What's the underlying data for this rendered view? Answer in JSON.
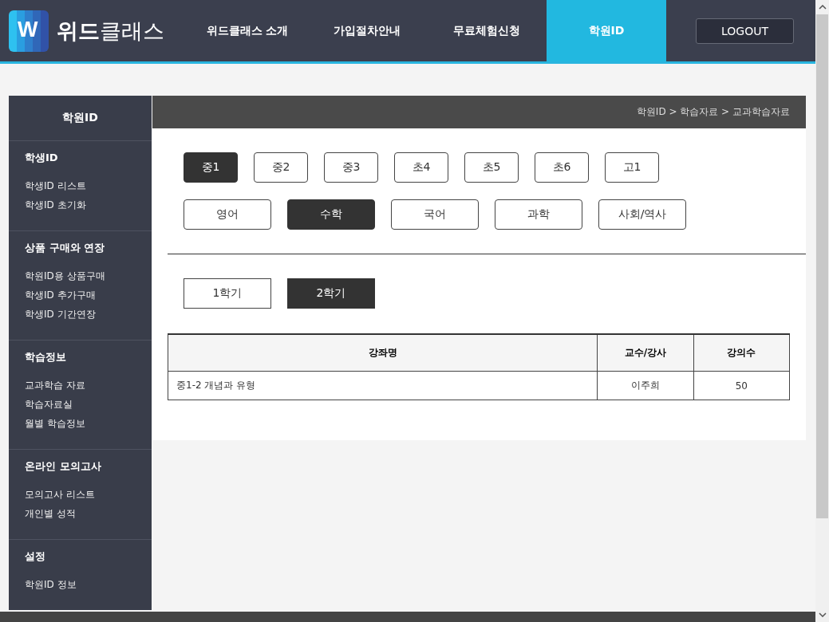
{
  "header": {
    "logo": {
      "mark": "W",
      "text": "**위드**클래스"
    },
    "nav": [
      {
        "label": "위드클래스 소개",
        "selected": false
      },
      {
        "label": "가입절차안내",
        "selected": false
      },
      {
        "label": "무료체험신청",
        "selected": false
      },
      {
        "label": "학원ID",
        "selected": true
      }
    ],
    "logout": "LOGOUT"
  },
  "sidebar": {
    "title": "학원ID",
    "sections": [
      {
        "heading": "학생ID",
        "items": [
          "학생ID 리스트",
          "학생ID 초기화"
        ]
      },
      {
        "heading": "상품 구매와 연장",
        "items": [
          "학원ID용 상품구매",
          "학생ID 추가구매",
          "학생ID 기간연장"
        ]
      },
      {
        "heading": "학습정보",
        "items": [
          "교과학습 자료",
          "학습자료실",
          "월별 학습정보"
        ]
      },
      {
        "heading": "온라인 모의고사",
        "items": [
          "모의고사 리스트",
          "개인별 성적"
        ]
      },
      {
        "heading": "설정",
        "items": [
          "학원ID 정보"
        ]
      }
    ]
  },
  "breadcrumb": "학원ID > 학습자료 > 교과학습자료",
  "grades": [
    {
      "label": "중1",
      "selected": true
    },
    {
      "label": "중2",
      "selected": false
    },
    {
      "label": "중3",
      "selected": false
    },
    {
      "label": "초4",
      "selected": false
    },
    {
      "label": "초5",
      "selected": false
    },
    {
      "label": "초6",
      "selected": false
    },
    {
      "label": "고1",
      "selected": false
    }
  ],
  "subjects": [
    {
      "label": "영어",
      "selected": false
    },
    {
      "label": "수학",
      "selected": true
    },
    {
      "label": "국어",
      "selected": false
    },
    {
      "label": "과학",
      "selected": false
    },
    {
      "label": "사회/역사",
      "selected": false
    }
  ],
  "semesters": [
    {
      "label": "1학기",
      "selected": false
    },
    {
      "label": "2학기",
      "selected": true
    }
  ],
  "table": {
    "columns": [
      "강좌명",
      "교수/강사",
      "강의수"
    ],
    "rows": [
      [
        "중1-2 개념과 유형",
        "이주희",
        "50"
      ]
    ]
  }
}
